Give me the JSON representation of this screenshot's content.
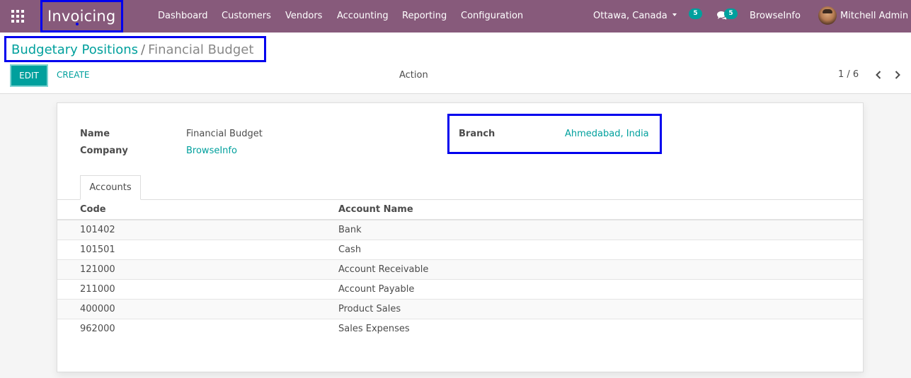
{
  "navbar": {
    "app_title": "Invoicing",
    "menu": [
      "Dashboard",
      "Customers",
      "Vendors",
      "Accounting",
      "Reporting",
      "Configuration"
    ],
    "branch_switcher": "Ottawa, Canada",
    "activity_count": "5",
    "message_count": "5",
    "company": "BrowseInfo",
    "user": "Mitchell Admin"
  },
  "breadcrumb": {
    "parent": "Budgetary Positions",
    "separator": "/",
    "current": "Financial Budget"
  },
  "toolbar": {
    "edit_label": "EDIT",
    "create_label": "CREATE",
    "action_label": "Action",
    "pager": "1 / 6"
  },
  "form": {
    "name_label": "Name",
    "name_value": "Financial Budget",
    "company_label": "Company",
    "company_value": "BrowseInfo",
    "branch_label": "Branch",
    "branch_value": "Ahmedabad, India"
  },
  "tabs": [
    {
      "label": "Accounts"
    }
  ],
  "accounts_table": {
    "headers": [
      "Code",
      "Account Name"
    ],
    "rows": [
      [
        "101402",
        "Bank"
      ],
      [
        "101501",
        "Cash"
      ],
      [
        "121000",
        "Account Receivable"
      ],
      [
        "211000",
        "Account Payable"
      ],
      [
        "400000",
        "Product Sales"
      ],
      [
        "962000",
        "Sales Expenses"
      ]
    ]
  },
  "colors": {
    "navbar": "#875a7b",
    "accent": "#00a09d",
    "highlight_border": "#0000ee"
  }
}
